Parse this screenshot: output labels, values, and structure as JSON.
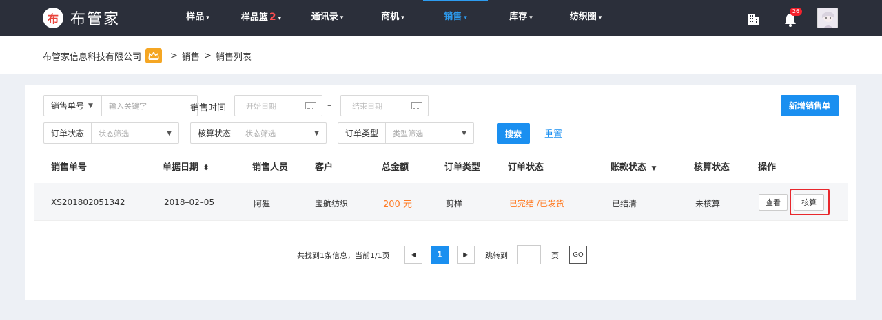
{
  "brand": {
    "logo_char": "布",
    "name": "布管家"
  },
  "nav": {
    "items": [
      {
        "label": "样品",
        "caret": "▾"
      },
      {
        "label": "样品篮",
        "badge": "2",
        "caret": "▾"
      },
      {
        "label": "通讯录",
        "caret": "▾"
      },
      {
        "label": "商机",
        "caret": "▾"
      },
      {
        "label": "销售",
        "caret": "▾"
      },
      {
        "label": "库存",
        "caret": "▾"
      },
      {
        "label": "纺织圈",
        "caret": "▾"
      }
    ],
    "active_index": 4,
    "notifications_count": "26"
  },
  "breadcrumb": {
    "company": "布管家信息科技有限公司",
    "sep": ">",
    "level1": "销售",
    "level2": "销售列表"
  },
  "filters": {
    "order_no_label": "销售单号",
    "order_no_placeholder": "输入关键字",
    "sale_time_label": "销售时间",
    "start_date_placeholder": "开始日期",
    "range_dash": "–",
    "end_date_placeholder": "结束日期",
    "order_status_label": "订单状态",
    "order_status_value": "状态筛选",
    "check_status_label": "核算状态",
    "check_status_value": "状态筛选",
    "order_type_label": "订单类型",
    "order_type_value": "类型筛选",
    "search_button": "搜索",
    "reset_link": "重置",
    "new_order_button": "新增销售单"
  },
  "table": {
    "columns": [
      "销售单号",
      "单据日期",
      "销售人员",
      "客户",
      "总金额",
      "订单类型",
      "订单状态",
      "账款状态",
      "核算状态",
      "操作"
    ],
    "sort_icon": "⬍",
    "filter_icon": "▼",
    "rows": [
      {
        "order_no": "XS201802051342",
        "date": "2018–02–05",
        "salesperson": "阿狸",
        "customer": "宝航纺织",
        "amount": "200 元",
        "type": "剪样",
        "status": "已完结 /已发货",
        "payment_status": "已结清",
        "check_status": "未核算",
        "actions": [
          "查看",
          "核算"
        ]
      }
    ]
  },
  "pagination": {
    "summary": "共找到1条信息，当前1/1页",
    "prev": "◀",
    "current": "1",
    "next": "▶",
    "jump_label": "跳转到",
    "page_unit": "页",
    "go": "GO"
  },
  "colors": {
    "nav_bg": "#2b2f3a",
    "accent": "#1a8ff0",
    "highlight": "#e8282d",
    "orange": "#ff7a22"
  }
}
